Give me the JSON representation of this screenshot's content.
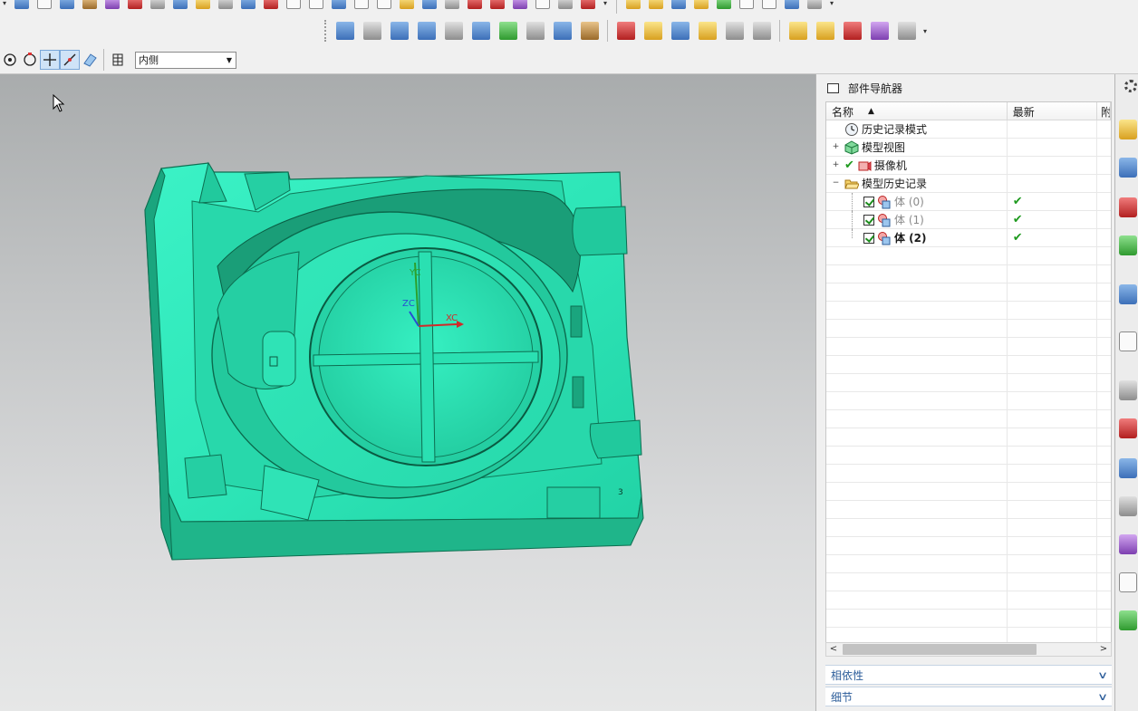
{
  "viewport": {
    "triad": {
      "x_label": "XC",
      "y_label": "YC",
      "z_label": "ZC"
    },
    "mark_text": "3"
  },
  "snap_toolbar": {
    "dropdown_value": "内侧"
  },
  "navigator": {
    "title": "部件导航器",
    "columns": {
      "name": "名称",
      "latest": "最新",
      "extra": "附"
    },
    "nodes": [
      {
        "label": "历史记录模式",
        "latest": ""
      },
      {
        "label": "模型视图",
        "latest": ""
      },
      {
        "label": "摄像机",
        "latest": ""
      },
      {
        "label": "模型历史记录",
        "latest": ""
      },
      {
        "label": "体 (0)",
        "latest": "✔"
      },
      {
        "label": "体 (1)",
        "latest": "✔"
      },
      {
        "label": "体 (2)",
        "latest": "✔"
      }
    ],
    "panels": {
      "dependencies": "相依性",
      "details": "细节"
    }
  },
  "colors": {
    "model_top": "#33eec0",
    "model_side": "#1fb98a",
    "model_dark": "#14946c",
    "check_green": "#1f9a1f",
    "panel_text": "#2c5d9a"
  },
  "icons": {
    "history_mode": "clock-icon",
    "model_views": "views-cube-icon",
    "cameras": "camera-icon",
    "model_history": "folder-open-icon",
    "body": "body-feature-icon"
  }
}
